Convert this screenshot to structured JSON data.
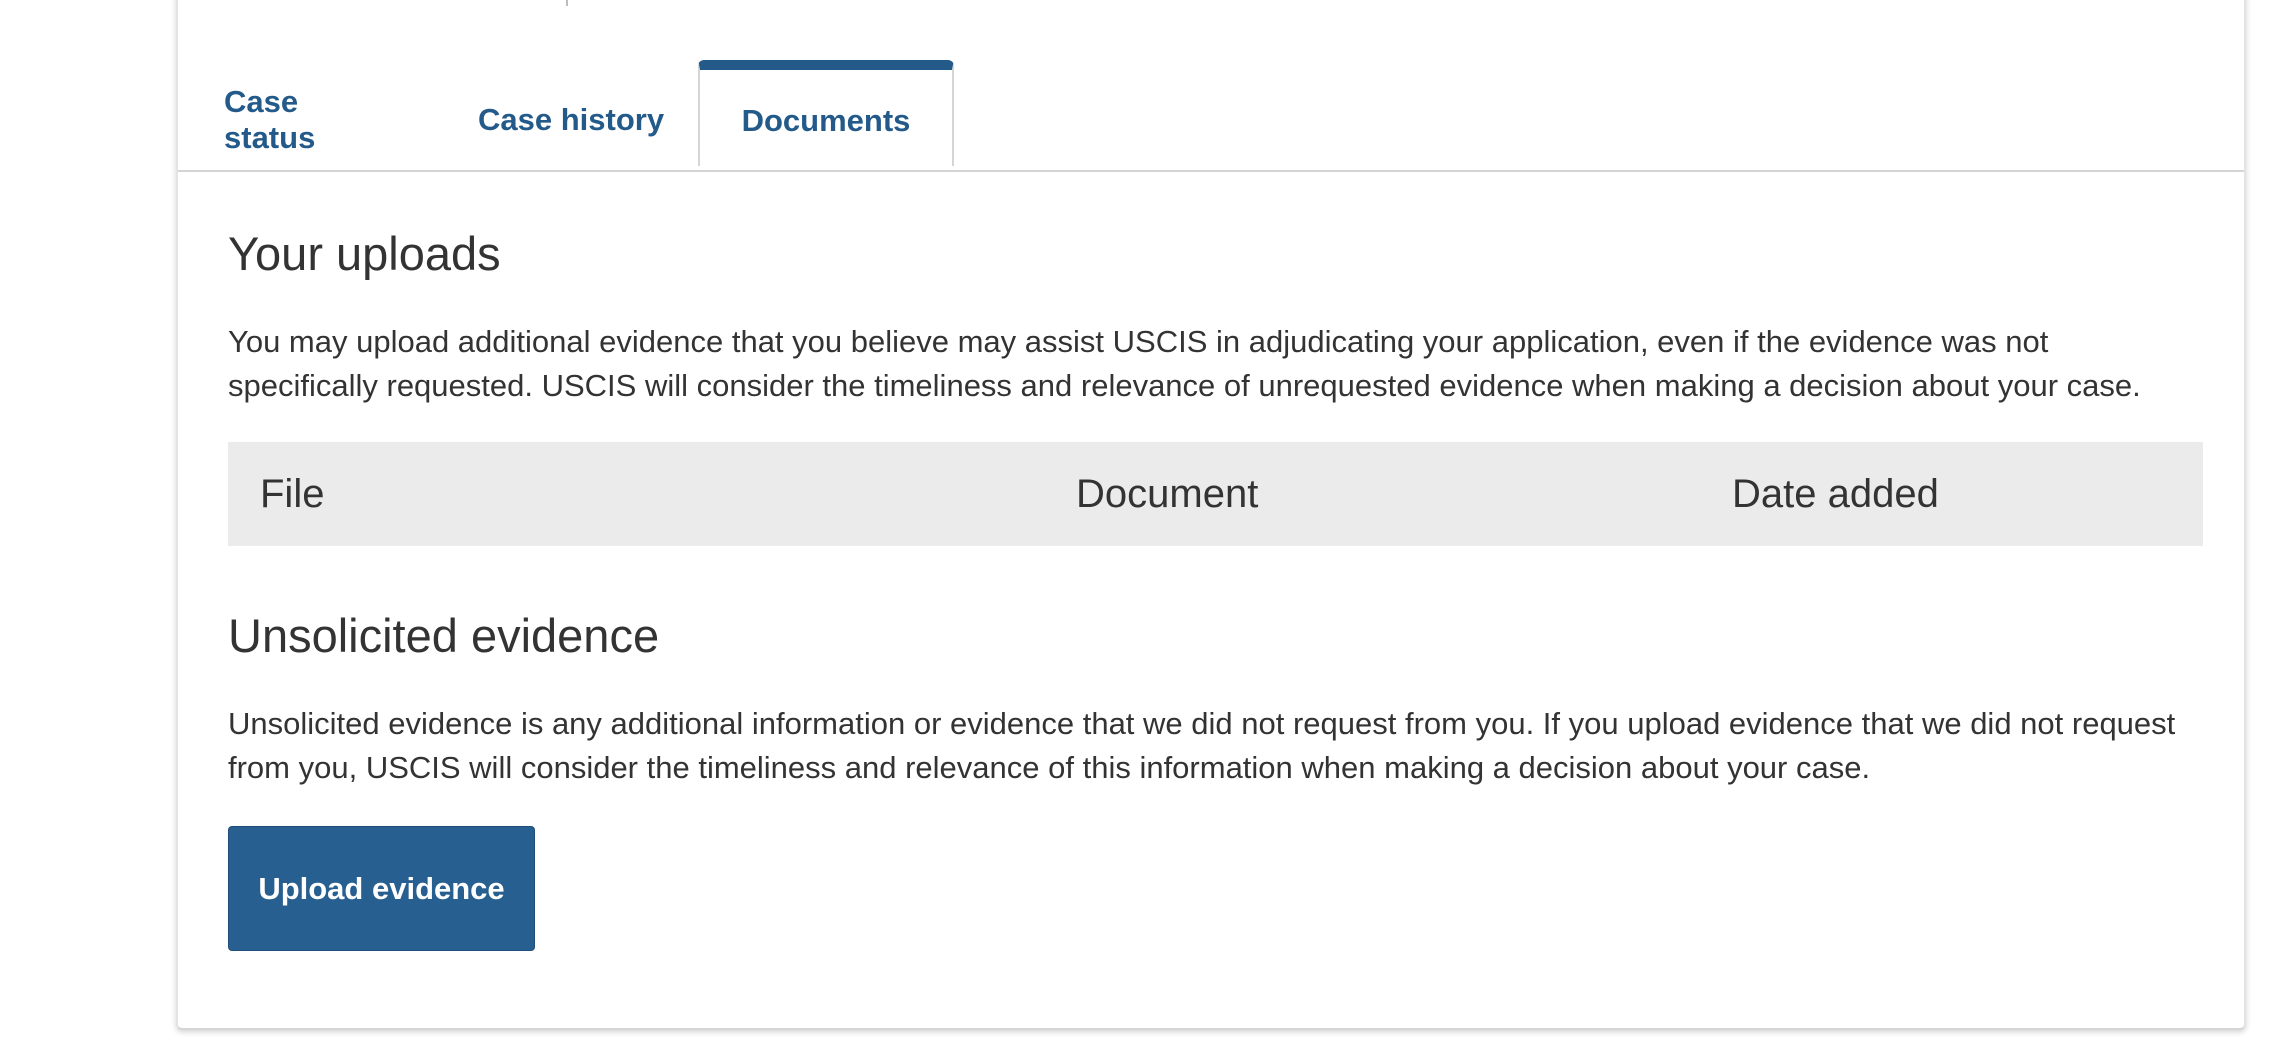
{
  "tabs": {
    "case_status": "Case status",
    "case_history": "Case history",
    "documents": "Documents",
    "active": "Documents"
  },
  "uploads": {
    "title": "Your uploads",
    "description": "You may upload additional evidence that you believe may assist USCIS in adjudicating your application, even if the evidence was not specifically requested. USCIS will consider the timeliness and relevance of unrequested evidence when making a decision about your case.",
    "table": {
      "columns": [
        "File",
        "Document",
        "Date added"
      ],
      "rows": []
    }
  },
  "unsolicited": {
    "title": "Unsolicited evidence",
    "description": "Unsolicited evidence is any additional information or evidence that we did not request from you. If you upload evidence that we did not request from you, USCIS will consider the timeliness and relevance of this information when making a decision about your case.",
    "button_label": "Upload evidence"
  },
  "colors": {
    "accent": "#235a8a",
    "button": "#275f91",
    "table_header_bg": "#ebebeb",
    "text": "#333333"
  }
}
